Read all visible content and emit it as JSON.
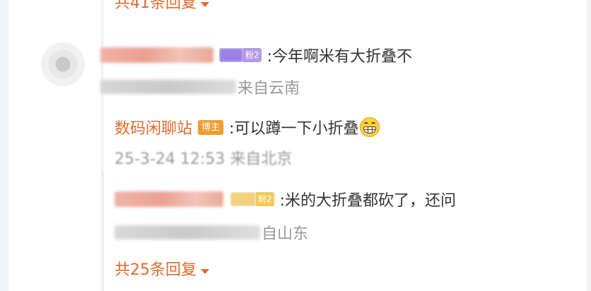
{
  "top_replies": {
    "label": "共41条回复"
  },
  "comment": {
    "author": "",
    "fan_badge": {
      "level": "粉2"
    },
    "text": ":今年啊米有大折叠不",
    "meta": "来自云南"
  },
  "replies": [
    {
      "author": "数码闲聊站",
      "role_badge": "博主",
      "text": ":可以蹲一下小折叠",
      "emoji": "grinning-face-emoji",
      "meta": "25-3-24 12:53 来自北京"
    },
    {
      "author": "",
      "fan_badge": {
        "level": "粉2"
      },
      "text": ":米的大折叠都砍了，还问",
      "meta": "自山东"
    }
  ],
  "bottom_replies": {
    "label": "共25条回复"
  },
  "colors": {
    "link": "#e06a2c",
    "blogger_badge": "#f39b2f",
    "fan_badge_purple": "#a88de0",
    "fan_badge_gold": "#f3cf6a",
    "meta_text": "#999999"
  }
}
